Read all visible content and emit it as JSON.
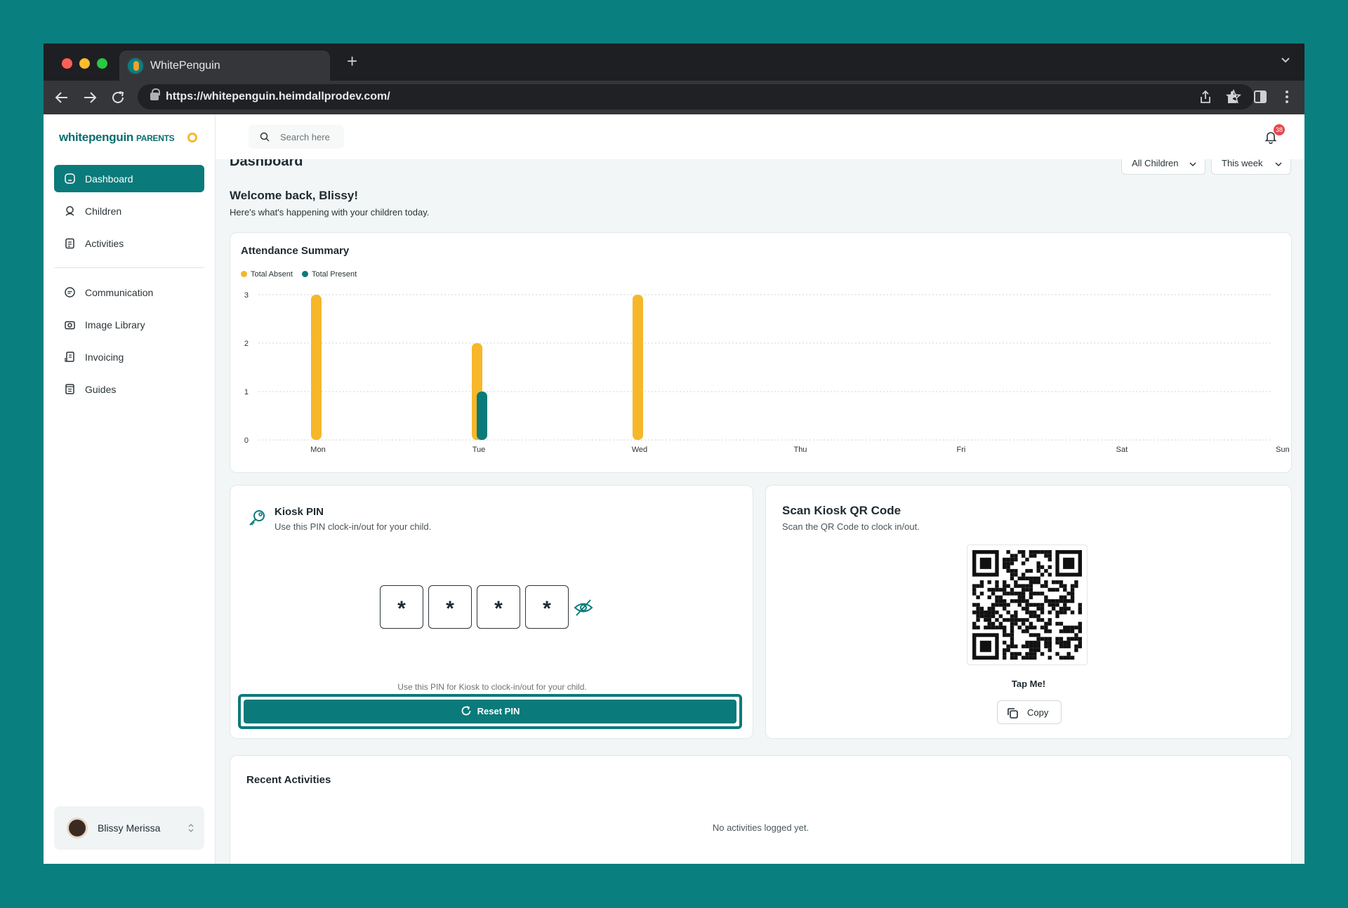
{
  "browser": {
    "tab_title": "WhitePenguin",
    "new_tab": "+",
    "url": "https://whitepenguin.heimdallprodev.com/"
  },
  "sidebar": {
    "logo": "whitepenguin",
    "logo_suffix": "PARENTS",
    "items": [
      {
        "label": "Dashboard",
        "icon": "home-icon",
        "active": true
      },
      {
        "label": "Children",
        "icon": "children-icon"
      },
      {
        "label": "Activities",
        "icon": "clipboard-icon"
      },
      {
        "label": "Communication",
        "icon": "chat-icon"
      },
      {
        "label": "Image Library",
        "icon": "camera-icon"
      },
      {
        "label": "Invoicing",
        "icon": "invoice-icon"
      },
      {
        "label": "Guides",
        "icon": "book-icon"
      }
    ],
    "user": {
      "name": "Blissy Merissa"
    }
  },
  "topbar": {
    "search_placeholder": "Search here",
    "notification_count": "38"
  },
  "page": {
    "title": "Dashboard",
    "filter_children": "All Children",
    "filter_period": "This week",
    "welcome": "Welcome back, Blissy!",
    "subtitle": "Here's what's happening with your children today."
  },
  "attendance": {
    "title": "Attendance Summary",
    "legend": [
      {
        "label": "Total Absent",
        "color": "#f6b72b"
      },
      {
        "label": "Total Present",
        "color": "#0b7a7a"
      }
    ]
  },
  "chart_data": {
    "type": "bar",
    "title": "Attendance Summary",
    "categories": [
      "Mon",
      "Tue",
      "Wed",
      "Thu",
      "Fri",
      "Sat",
      "Sun"
    ],
    "series": [
      {
        "name": "Total Absent",
        "values": [
          3,
          2,
          3,
          0,
          0,
          0,
          0
        ],
        "color": "#f6b72b"
      },
      {
        "name": "Total Present",
        "values": [
          0,
          1,
          0,
          0,
          0,
          0,
          0
        ],
        "color": "#0b7a7a"
      }
    ],
    "yticks": [
      "0",
      "1",
      "2",
      "3"
    ],
    "ylim": [
      0,
      3
    ],
    "grid": true,
    "legend_position": "top-left"
  },
  "kiosk": {
    "title": "Kiosk PIN",
    "subtitle": "Use this PIN clock-in/out for your child.",
    "pin": [
      "*",
      "*",
      "*",
      "*"
    ],
    "hint": "Use this PIN for Kiosk to clock-in/out for your child.",
    "reset_label": "Reset PIN"
  },
  "qr": {
    "title": "Scan Kiosk QR Code",
    "subtitle": "Scan the QR Code to clock in/out.",
    "tap_label": "Tap Me!",
    "copy_label": "Copy"
  },
  "recent": {
    "title": "Recent Activities",
    "empty": "No activities logged yet."
  }
}
